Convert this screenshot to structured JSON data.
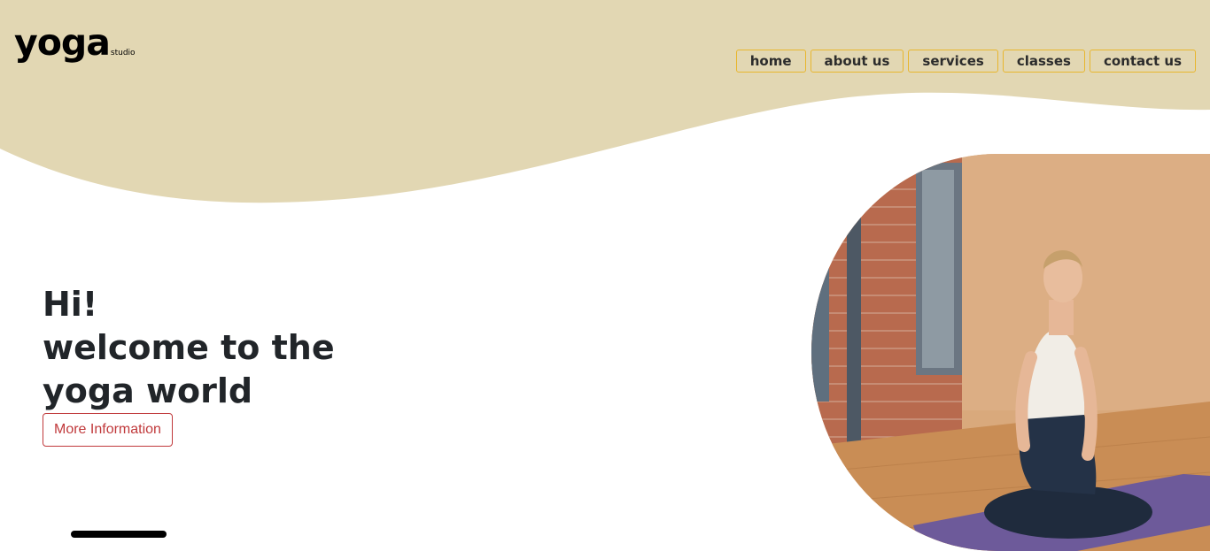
{
  "brand": {
    "name": "yoga",
    "suffix": "studio"
  },
  "nav": {
    "items": [
      {
        "label": "home"
      },
      {
        "label": "about us"
      },
      {
        "label": "services"
      },
      {
        "label": "classes"
      },
      {
        "label": "contact us"
      }
    ]
  },
  "hero": {
    "line1": "Hi!",
    "line2": "welcome to the",
    "line3": "yoga world",
    "button_label": "More Information"
  },
  "colors": {
    "wave": "#e2d7b3",
    "nav_border": "#e8b62e",
    "button_accent": "#c0393b"
  },
  "hero_image": {
    "description_icon": "meditation-photo"
  }
}
